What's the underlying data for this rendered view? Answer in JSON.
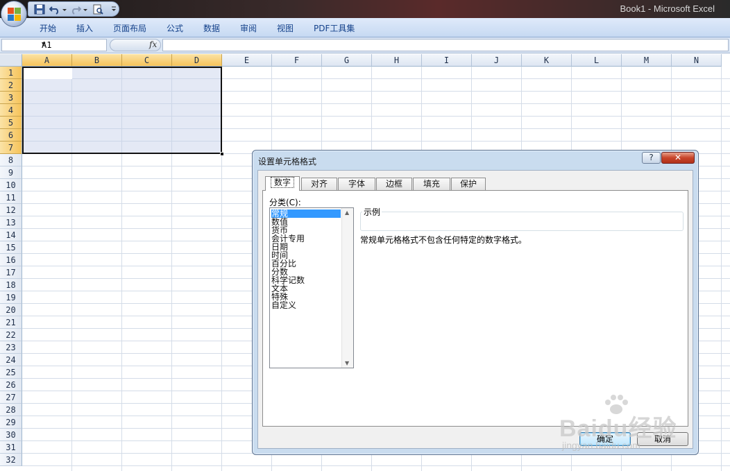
{
  "window": {
    "title": "Book1 - Microsoft Excel"
  },
  "ribbon": {
    "tabs": [
      "开始",
      "插入",
      "页面布局",
      "公式",
      "数据",
      "审阅",
      "视图",
      "PDF工具集"
    ]
  },
  "formula_bar": {
    "name_box": "A1",
    "fx_label": "fx",
    "value": ""
  },
  "grid": {
    "columns": [
      "A",
      "B",
      "C",
      "D",
      "E",
      "F",
      "G",
      "H",
      "I",
      "J",
      "K",
      "L",
      "M",
      "N"
    ],
    "rows": [
      "1",
      "2",
      "3",
      "4",
      "5",
      "6",
      "7",
      "8",
      "9",
      "10",
      "11",
      "12",
      "13",
      "14",
      "15",
      "16",
      "17",
      "18",
      "19",
      "20",
      "21",
      "22",
      "23",
      "24",
      "25",
      "26",
      "27",
      "28",
      "29",
      "30",
      "31",
      "32"
    ],
    "selected_columns": [
      "A",
      "B",
      "C",
      "D"
    ],
    "selected_rows": [
      "1",
      "2",
      "3",
      "4",
      "5",
      "6",
      "7"
    ]
  },
  "dialog": {
    "title": "设置单元格格式",
    "help_label": "?",
    "close_label": "✕",
    "tabs": [
      "数字",
      "对齐",
      "字体",
      "边框",
      "填充",
      "保护"
    ],
    "active_tab": "数字",
    "category_label": "分类(C):",
    "categories": [
      "常规",
      "数值",
      "货币",
      "会计专用",
      "日期",
      "时间",
      "百分比",
      "分数",
      "科学记数",
      "文本",
      "特殊",
      "自定义"
    ],
    "selected_category": "常规",
    "sample_label": "示例",
    "description": "常规单元格格式不包含任何特定的数字格式。",
    "ok_label": "确定",
    "cancel_label": "取消"
  },
  "watermark": {
    "text": "Baidu经验",
    "url": "jingyan.baidu.com"
  },
  "colors": {
    "accent": "#15428b",
    "selection_header": "#f6c35a",
    "list_highlight": "#3399ff"
  }
}
